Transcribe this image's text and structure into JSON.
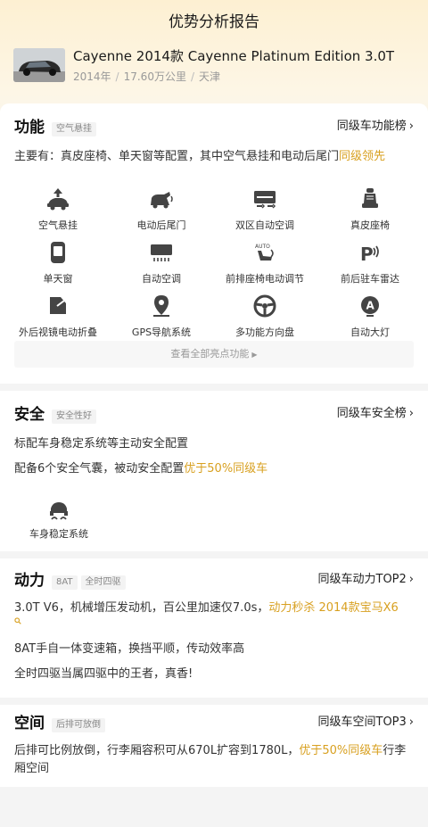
{
  "header": {
    "title": "优势分析报告",
    "car_name": "Cayenne 2014款 Cayenne Platinum Edition 3.0T",
    "year": "2014年",
    "mileage": "17.60万公里",
    "city": "天津",
    "separator": "/"
  },
  "function": {
    "title": "功能",
    "tag": "空气悬挂",
    "rank": "同级车功能榜",
    "summary_prefix": "主要有：真皮座椅、单天窗等配置，其中空气悬挂和电动后尾门",
    "summary_highlight": "同级领先",
    "features": [
      {
        "label": "空气悬挂",
        "icon": "air-suspension-icon"
      },
      {
        "label": "电动后尾门",
        "icon": "power-tailgate-icon"
      },
      {
        "label": "双区自动空调",
        "icon": "dual-zone-ac-icon"
      },
      {
        "label": "真皮座椅",
        "icon": "leather-seat-icon"
      },
      {
        "label": "单天窗",
        "icon": "sunroof-icon"
      },
      {
        "label": "自动空调",
        "icon": "auto-ac-icon"
      },
      {
        "label": "前排座椅电动调节",
        "icon": "power-seat-icon"
      },
      {
        "label": "前后驻车雷达",
        "icon": "parking-radar-icon"
      },
      {
        "label": "外后视镜电动折叠",
        "icon": "mirror-fold-icon"
      },
      {
        "label": "GPS导航系统",
        "icon": "gps-icon"
      },
      {
        "label": "多功能方向盘",
        "icon": "steering-wheel-icon"
      },
      {
        "label": "自动大灯",
        "icon": "auto-headlight-icon"
      }
    ],
    "see_all": "查看全部亮点功能"
  },
  "safety": {
    "title": "安全",
    "tag": "安全性好",
    "rank": "同级车安全榜",
    "line1": "标配车身稳定系统等主动安全配置",
    "line2_prefix": "配备6个安全气囊，被动安全配置",
    "line2_highlight": "优于50%同级车",
    "item_label": "车身稳定系统"
  },
  "power": {
    "title": "动力",
    "tags": [
      "8AT",
      "全时四驱"
    ],
    "rank": "同级车动力TOP2",
    "line1_prefix": "3.0T V6，机械增压发动机，百公里加速仅7.0s，",
    "line1_highlight": "动力秒杀 2014款宝马X6",
    "line2": "8AT手自一体变速箱，换挡平顺，传动效率高",
    "line3": "全时四驱当属四驱中的王者，真香!"
  },
  "space": {
    "title": "空间",
    "tag": "后排可放倒",
    "rank": "同级车空间TOP3",
    "line1_prefix": "后排可比例放倒，行李厢容积可从670L扩容到1780L，",
    "line1_highlight": "优于50%同级车",
    "line1_suffix": "行李",
    "line2": "厢空间"
  },
  "colors": {
    "accent": "#d8a020",
    "hero_bg": "#fdf0d2",
    "icon": "#444444"
  }
}
